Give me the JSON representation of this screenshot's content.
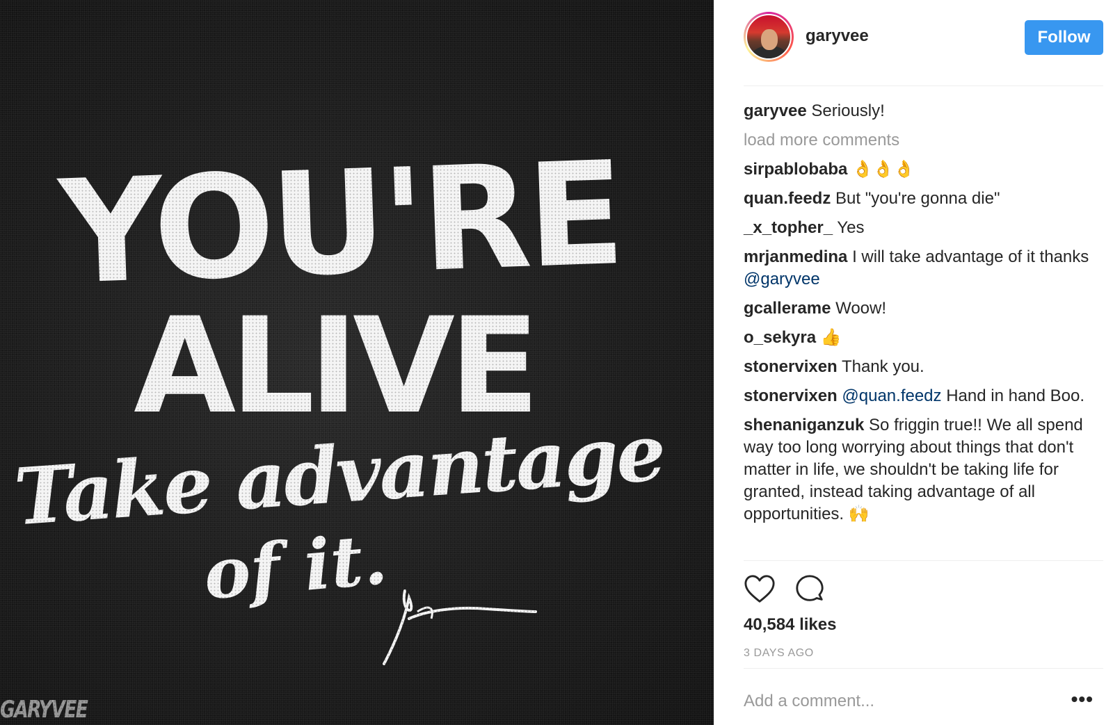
{
  "post": {
    "image_alt_text_lines": [
      "YOU'RE",
      "ALIVE",
      "Take advantage",
      "of it."
    ],
    "watermark": "GARYVEE"
  },
  "header": {
    "username": "garyvee",
    "follow_label": "Follow"
  },
  "caption": {
    "user": "garyvee",
    "text": "Seriously!"
  },
  "load_more_label": "load more comments",
  "comments": [
    {
      "user": "sirpablobaba",
      "text": "👌👌👌"
    },
    {
      "user": "quan.feedz",
      "text": "But \"you're gonna die\""
    },
    {
      "user": "_x_topher_",
      "text": "Yes"
    },
    {
      "user": "mrjanmedina",
      "text": "I will take advantage of it thanks",
      "mention": "@garyvee"
    },
    {
      "user": "gcallerame",
      "text": "Woow!"
    },
    {
      "user": "o_sekyra",
      "text": "👍"
    },
    {
      "user": "stonervixen",
      "text": "Thank you."
    },
    {
      "user": "stonervixen",
      "mention": "@quan.feedz",
      "text": "Hand in hand Boo."
    },
    {
      "user": "shenaniganzuk",
      "text": "So friggin true!! We all spend way too long worrying about things that don't matter in life, we shouldn't be taking life for granted, instead taking advantage of all opportunities. 🙌"
    }
  ],
  "actions": {
    "like_icon": "heart-icon",
    "comment_icon": "comment-bubble-icon",
    "likes": "40,584 likes",
    "timestamp": "3 DAYS AGO"
  },
  "add_comment_placeholder": "Add a comment...",
  "more_options_label": "•••",
  "colors": {
    "follow_button": "#3897f0",
    "mention": "#003569",
    "muted": "#999999",
    "photo_background": "#1c1c1c"
  }
}
